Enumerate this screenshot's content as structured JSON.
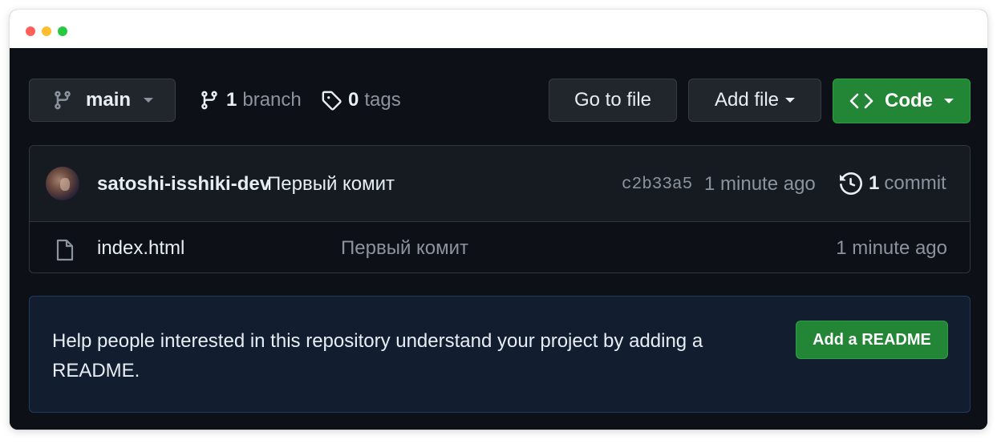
{
  "window": {
    "controls": [
      "close",
      "minimize",
      "maximize"
    ]
  },
  "toolbar": {
    "branch_selector": {
      "label": "main",
      "icon": "git-branch-icon"
    },
    "branches": {
      "count": "1",
      "label": "branch",
      "icon": "git-branch-icon"
    },
    "tags": {
      "count": "0",
      "label": "tags",
      "icon": "tag-icon"
    },
    "go_to_file_label": "Go to file",
    "add_file_label": "Add file",
    "code_label": "Code"
  },
  "latest_commit": {
    "author": "satoshi-isshiki-dev",
    "message": "Первый комит",
    "sha": "c2b33a5",
    "time": "1 minute ago",
    "commit_count": "1",
    "commit_count_label": "commit"
  },
  "files": [
    {
      "name": "index.html",
      "message": "Первый комит",
      "time": "1 minute ago",
      "icon": "file-icon"
    }
  ],
  "readme_prompt": {
    "text": "Help people interested in this repository understand your project by adding a README.",
    "button_label": "Add a README"
  },
  "colors": {
    "background": "#0d1117",
    "panel": "#161b22",
    "button": "#21262d",
    "accent_green": "#238636",
    "text": "#e6edf3",
    "muted": "#8b949e",
    "readme_bg": "#121d2f"
  }
}
